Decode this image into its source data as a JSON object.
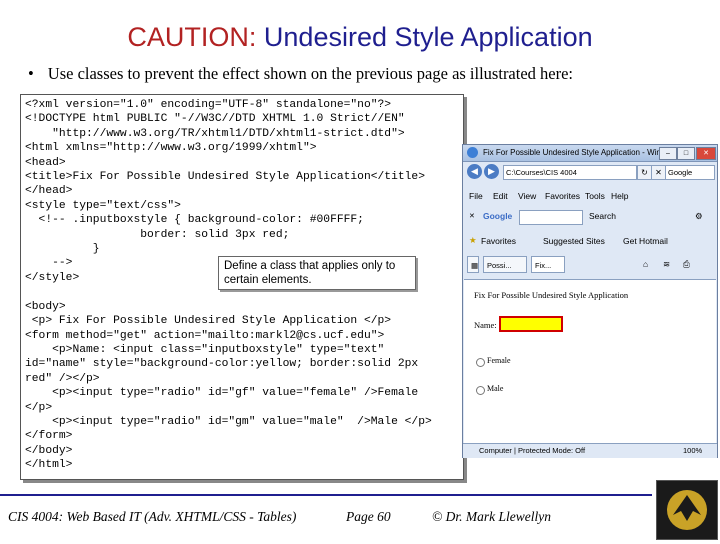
{
  "title": {
    "prefix": "CAUTION:",
    "rest": " Undesired Style Application"
  },
  "bullet": {
    "symbol": "•",
    "text": "Use classes to prevent the effect shown on the previous page as illustrated here:"
  },
  "code": "<?xml version=\"1.0\" encoding=\"UTF-8\" standalone=\"no\"?>\n<!DOCTYPE html PUBLIC \"-//W3C//DTD XHTML 1.0 Strict//EN\"\n    \"http://www.w3.org/TR/xhtml1/DTD/xhtml1-strict.dtd\">\n<html xmlns=\"http://www.w3.org/1999/xhtml\">\n<head>\n<title>Fix For Possible Undesired Style Application</title>\n</head>\n<style type=\"text/css\">\n  <!-- .inputboxstyle { background-color: #00FFFF;\n                 border: solid 3px red;\n          }\n    -->\n</style>\n\n<body>\n <p> Fix For Possible Undesired Style Application </p>\n<form method=\"get\" action=\"mailto:markl2@cs.ucf.edu\">\n    <p>Name: <input class=\"inputboxstyle\" type=\"text\"\nid=\"name\" style=\"background-color:yellow; border:solid 2px\nred\" /></p>\n    <p><input type=\"radio\" id=\"gf\" value=\"female\" />Female\n</p>\n    <p><input type=\"radio\" id=\"gm\" value=\"male\"  />Male </p>\n</form>\n</body>\n</html>",
  "callout": "Define a class that applies only to certain elements.",
  "browser": {
    "window_title": "Fix For Possible Undesired Style Application - Windo...",
    "address": "C:\\Courses\\CIS 4004",
    "google_box": "Google",
    "menu": [
      "File",
      "Edit",
      "View",
      "Favorites",
      "Tools",
      "Help"
    ],
    "google_label": "Google",
    "search_label": "Search",
    "fav_items": [
      "Favorites",
      "Suggested Sites",
      "Get Hotmail"
    ],
    "tabs": [
      "Possi...",
      "Fix..."
    ],
    "page_heading": "Fix For Possible Undesired Style Application",
    "name_label": "Name:",
    "radio_female": "Female",
    "radio_male": "Male",
    "status_text": "Computer | Protected Mode: Off",
    "zoom": "100%"
  },
  "footer": {
    "course": "CIS 4004: Web Based IT (Adv. XHTML/CSS - Tables)",
    "page": "Page 60",
    "author": "© Dr. Mark Llewellyn"
  },
  "colors": {
    "title": "#1f1f8f",
    "caution": "#b22222",
    "name_box": "#ffff00",
    "name_border": "#d00000"
  }
}
